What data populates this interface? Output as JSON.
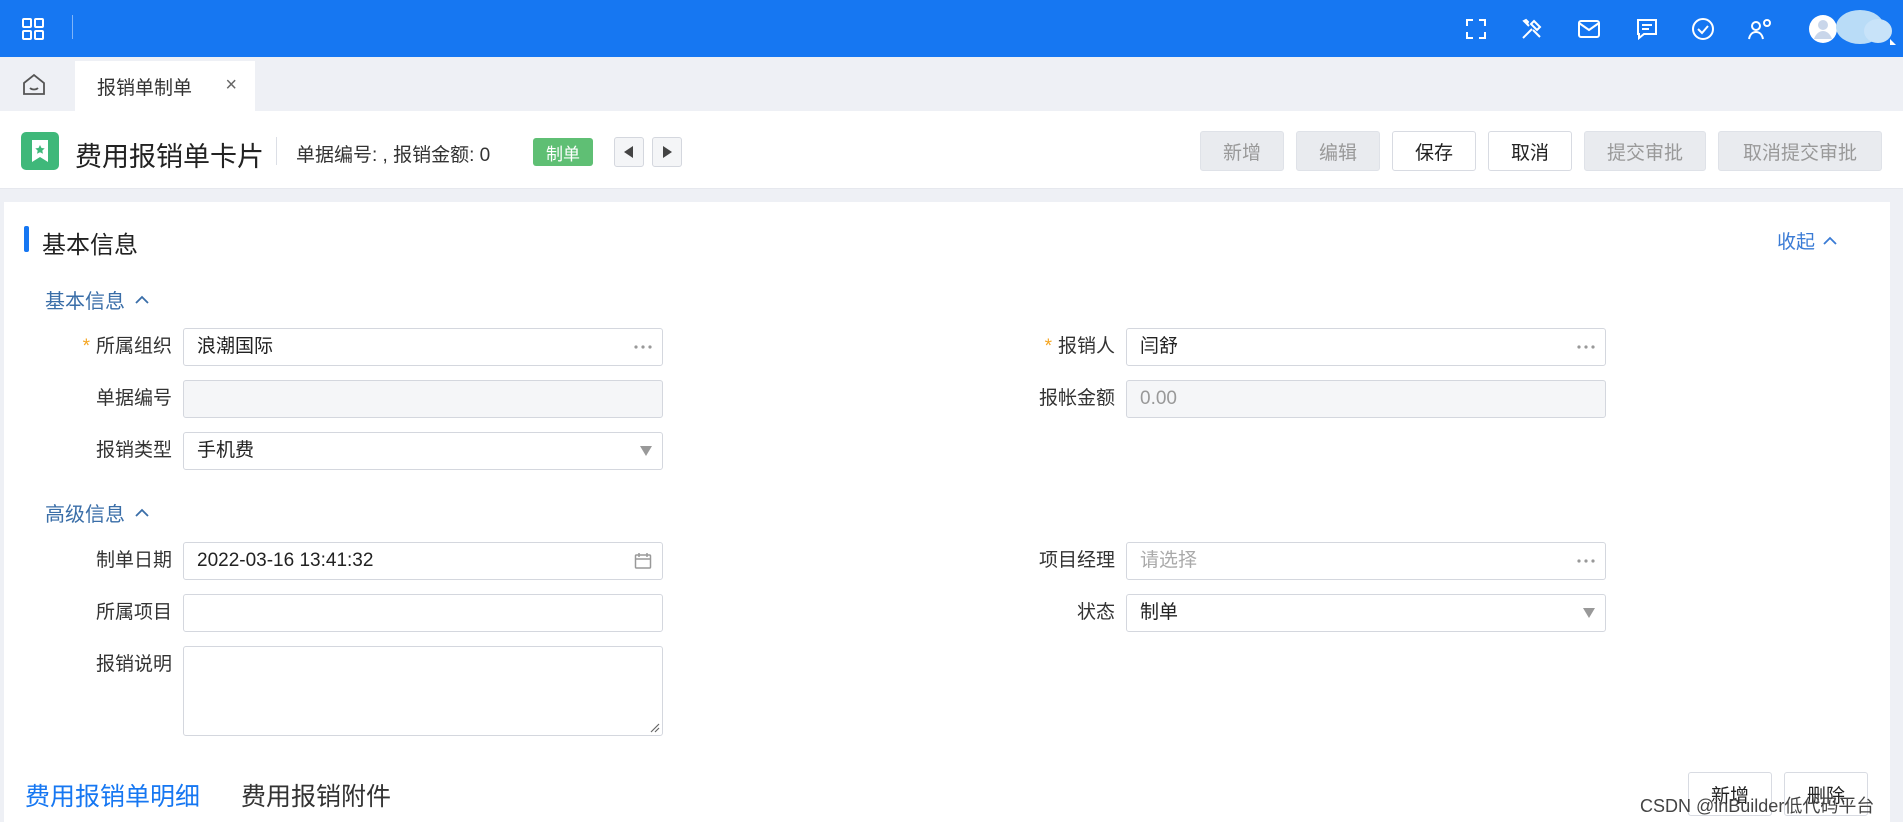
{
  "topbar": {
    "icons": [
      "apps-grid-icon",
      "fullscreen-icon",
      "tools-icon",
      "mail-icon",
      "message-icon",
      "check-circle-icon",
      "user-settings-icon",
      "avatar"
    ]
  },
  "tabs": [
    {
      "label": "报销单制单",
      "close": "×"
    }
  ],
  "header": {
    "title": "费用报销单卡片",
    "bill_info": "单据编号: , 报销金额: 0",
    "status": "制单",
    "buttons": {
      "add": "新增",
      "edit": "编辑",
      "save": "保存",
      "cancel": "取消",
      "submit": "提交审批",
      "cancel_submit": "取消提交审批"
    }
  },
  "section": {
    "title": "基本信息",
    "collapse": "收起"
  },
  "basic": {
    "title": "基本信息",
    "org": {
      "label": "所属组织",
      "value": "浪潮国际",
      "required": "*"
    },
    "reimburser": {
      "label": "报销人",
      "value": "闫舒",
      "required": "*"
    },
    "bill_no": {
      "label": "单据编号",
      "value": ""
    },
    "amount": {
      "label": "报帐金额",
      "value": "0.00"
    },
    "type": {
      "label": "报销类型",
      "value": "手机费"
    }
  },
  "advanced": {
    "title": "高级信息",
    "date": {
      "label": "制单日期",
      "value": "2022-03-16 13:41:32"
    },
    "pm": {
      "label": "项目经理",
      "placeholder": "请选择"
    },
    "project": {
      "label": "所属项目",
      "value": ""
    },
    "status": {
      "label": "状态",
      "value": "制单"
    },
    "note": {
      "label": "报销说明",
      "value": ""
    }
  },
  "detail_tabs": {
    "detail": "费用报销单明细",
    "attachments": "费用报销附件",
    "add": "新增",
    "delete": "删除"
  },
  "watermark": "CSDN @inBuilder低代码平台",
  "colors": {
    "primary": "#1677f2",
    "status_green": "#5fbf74",
    "card_icon": "#3fb87a"
  }
}
